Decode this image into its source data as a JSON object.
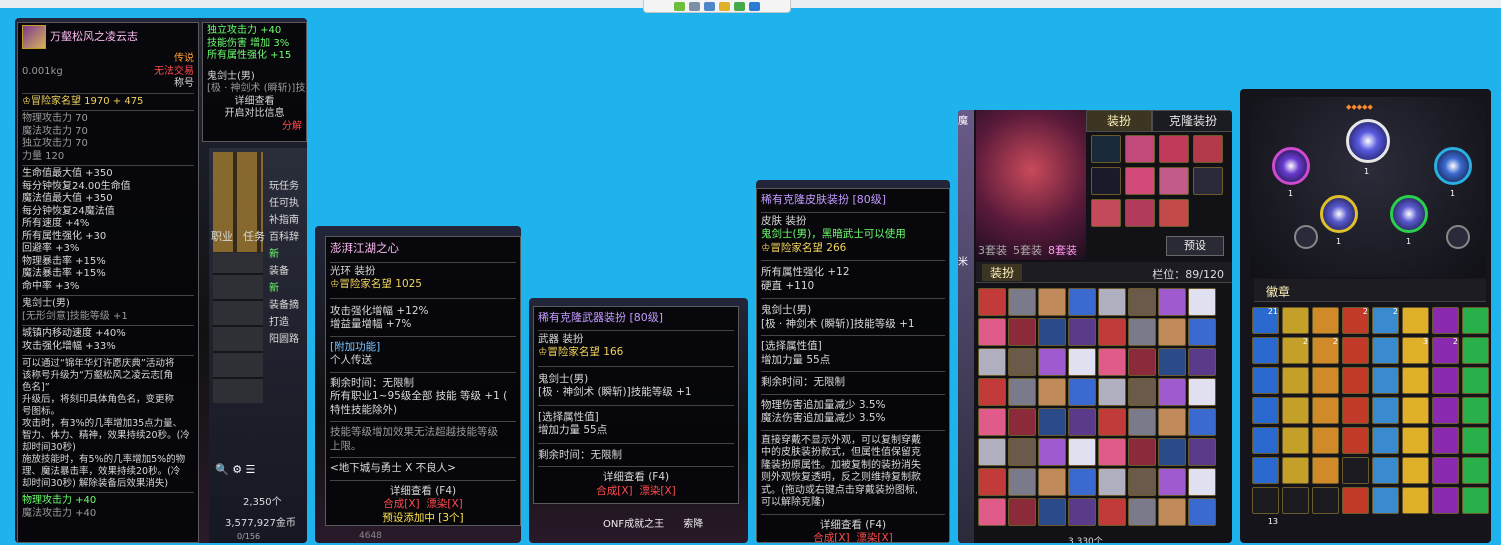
{
  "colors": {
    "background": "#1fb3ee",
    "tooltip_bg": "#06060a",
    "gold": "#f2d35a",
    "purple_title": "#ffbcf2",
    "orange": "#ff9a2f",
    "red": "#ff4b4b",
    "green": "#6cff6c"
  },
  "viewer": {
    "toolbar_icons": [
      "add-icon",
      "save-icon",
      "doc-icon",
      "edit-icon",
      "check-icon",
      "bookmark-icon"
    ]
  },
  "shot1": {
    "title": "万壑松风之凌云志",
    "rarity": "传说",
    "trade": "无法交易",
    "type": "称号",
    "weight": "0.001kg",
    "fame": "冒险家名望 1970 + 475",
    "stats_grey": [
      "物理攻击力 70",
      "魔法攻击力 70",
      "独立攻击力 70",
      "力量 120"
    ],
    "stats_main": [
      "生命值最大值 +350",
      "每分钟恢复24.00生命值",
      "魔法值最大值 +350",
      "每分钟恢复24魔法值",
      "所有速度 +4%",
      "所有属性强化 +30",
      "回避率 +3%",
      "物理暴击率 +15%",
      "魔法暴击率 +15%",
      "命中率 +3%"
    ],
    "class_line": "鬼剑士(男)",
    "skill_line": "[无形剑意]技能等级 +1",
    "extra": [
      "城镇内移动速度 +40%",
      "攻击强化增幅 +33%"
    ],
    "desc": [
      "可以通过“锦年华灯许愿庆典”活动将",
      "该称号升级为“万壑松风之凌云志[角",
      "色名]”",
      "升级后，将刻印具体角色名，变更称",
      "号图标。",
      "攻击时，有3%的几率增加35点力量、",
      "智力、体力、精神，效果持续20秒。(冷",
      "却时间30秒)",
      "施放技能时，有5%的几率增加5%的物",
      "理、魔法暴击率，效果持续20秒。(冷",
      "却时间30秒) 解除装备后效果消失)"
    ],
    "bottom": [
      "物理攻击力 +40",
      "魔法攻击力 +40"
    ],
    "side_tip": [
      "独立攻击力 +40",
      "技能伤害 增加 3%",
      "所有属性强化 +15",
      "鬼剑士(男)",
      "[极 · 神剑术 (瞬斩)]技能",
      "详细查看",
      "开启对比信息",
      "分解"
    ],
    "side_labels": [
      "玩任务",
      "任可执",
      "补指南",
      "百科辞",
      "新",
      "装备",
      "新",
      "装备摘",
      "打造",
      "阳圆路"
    ],
    "tabs": [
      "职业",
      "任务"
    ],
    "gold_value": "2,350个",
    "money": "3,577,927金币",
    "count": "0/156"
  },
  "shot2": {
    "title": "澎湃江湖之心",
    "type": "光环 装扮",
    "fame": "冒险家名望 1025",
    "stats": [
      "攻击强化增幅 +12%",
      "增益量增幅 +7%"
    ],
    "add_func": "[附加功能]",
    "add_func_val": "个人传送",
    "remain": "剩余时间：无限制",
    "skill": [
      "所有职业1~95级全部 技能 等级 +1 (",
      "特性技能除外)"
    ],
    "note": [
      "技能等级增加效果无法超越技能等级",
      "上限。"
    ],
    "source": "<地下城与勇士 X 不良人>",
    "actions": [
      "详细查看 (F4)",
      "合成[X]",
      "漂染[X]",
      "预设添加中 [3个]"
    ],
    "bg_number": "4648"
  },
  "shot3": {
    "title": "稀有克隆武器装扮 [80级]",
    "type": "武器 装扮",
    "fame": "冒险家名望 166",
    "class_line": "鬼剑士(男)",
    "skill": "[极 · 神剑术 (瞬斩)]技能等级 +1",
    "select": "[选择属性值]",
    "select_val": "增加力量 55点",
    "remain": "剩余时间：无限制",
    "actions": [
      "详细查看 (F4)",
      "合成[X]",
      "漂染[X]"
    ],
    "bg_text": [
      "ONF成就之王",
      "索降"
    ]
  },
  "shot4": {
    "title": "稀有克隆皮肤装扮 [80级]",
    "type": "皮肤 装扮",
    "class_line": "鬼剑士(男)，黑暗武士可以使用",
    "fame": "冒险家名望 266",
    "stats": [
      "所有属性强化 +12",
      "硬直 +110"
    ],
    "class2": "鬼剑士(男)",
    "skill": "[极 · 神剑术 (瞬斩)]技能等级 +1",
    "select": "[选择属性值]",
    "select_val": "增加力量 55点",
    "remain": "剩余时间：无限制",
    "reduce": [
      "物理伤害追加量减少 3.5%",
      "魔法伤害追加量减少 3.5%"
    ],
    "desc": [
      "直接穿戴不显示外观，可以复制穿戴",
      "中的皮肤装扮款式，但属性值保留克",
      "隆装扮原属性。加被复制的装扮消失",
      "则外观恢复透明，反之则维持复制款",
      "式。(拖动或右键点击穿戴装扮图标,",
      "可以解除克隆)"
    ],
    "actions": [
      "详细查看 (F4)",
      "合成[X]",
      "漂染[X]"
    ]
  },
  "shot5": {
    "tabs": [
      "装扮",
      "克隆装扮"
    ],
    "sets": [
      "3套装",
      "5套装",
      "8套装"
    ],
    "preset": "预设",
    "sub_tab": "装扮",
    "slot_label": "栏位：89/120",
    "side": [
      "魔",
      "米"
    ],
    "money": "3,330个"
  },
  "shot6": {
    "tab": "徽章",
    "dots_top": "◆◆◆◆◆",
    "node_counts": [
      "1",
      "1",
      "1",
      "1",
      "1"
    ],
    "badge_numbers": [
      "21",
      "2",
      "2",
      "2",
      "2",
      "3",
      "2",
      "13"
    ]
  }
}
